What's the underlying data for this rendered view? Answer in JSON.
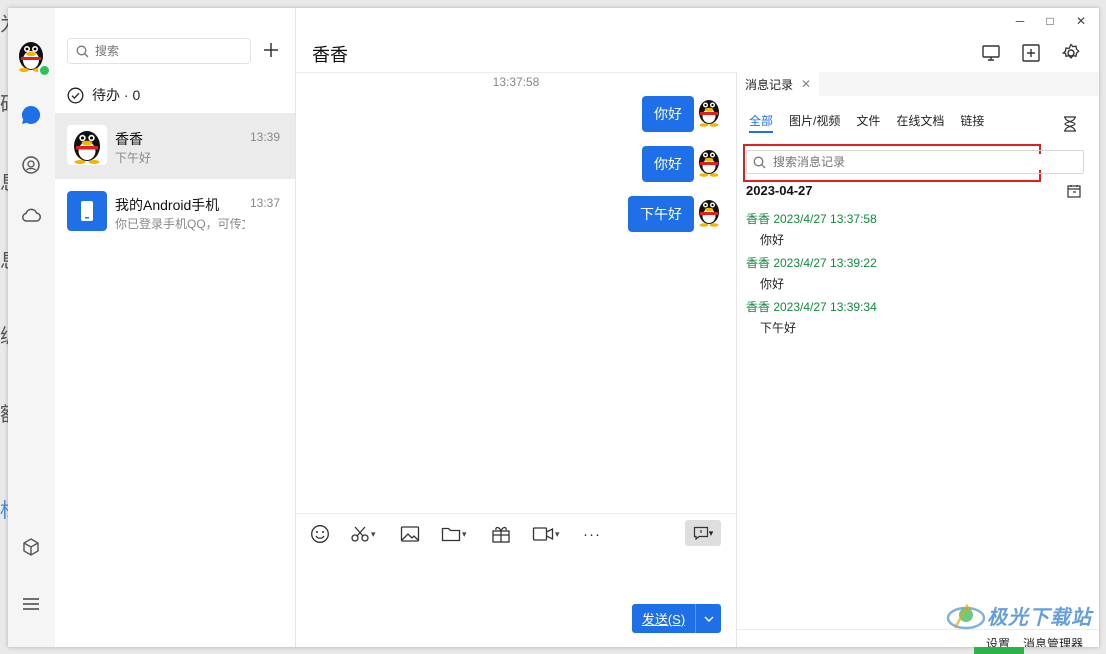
{
  "background": {
    "texts": [
      "为",
      "码",
      "息",
      "息",
      "编",
      "额",
      "标"
    ]
  },
  "window": {
    "minimize": "─",
    "maximize": "□",
    "close": "✕"
  },
  "contacts": {
    "search_placeholder": "搜索",
    "todo_label": "待办 · 0",
    "items": [
      {
        "name": "香香",
        "preview": "下午好",
        "time": "13:39"
      },
      {
        "name": "我的Android手机",
        "preview": "你已登录手机QQ，可传文件",
        "time": "13:37"
      }
    ]
  },
  "chat": {
    "title": "香香",
    "timestamp": "13:37:58",
    "messages": [
      "你好",
      "你好",
      "下午好"
    ],
    "send_label": "发送(S)",
    "more_label": "···"
  },
  "history": {
    "tab_label": "消息记录",
    "filters": [
      "全部",
      "图片/视频",
      "文件",
      "在线文档",
      "链接"
    ],
    "search_placeholder": "搜索消息记录",
    "date": "2023-04-27",
    "entries": [
      {
        "header": "香香 2023/4/27 13:37:58",
        "text": "你好"
      },
      {
        "header": "香香 2023/4/27 13:39:22",
        "text": "你好"
      },
      {
        "header": "香香 2023/4/27 13:39:34",
        "text": "下午好"
      }
    ],
    "footer": {
      "settings": "设置",
      "manager": "消息管理器"
    }
  },
  "watermark": {
    "text": "极光下载站"
  },
  "colors": {
    "accent": "#1e6fe8",
    "history_sender": "#0f8a3c",
    "highlight_box": "#e02020"
  }
}
